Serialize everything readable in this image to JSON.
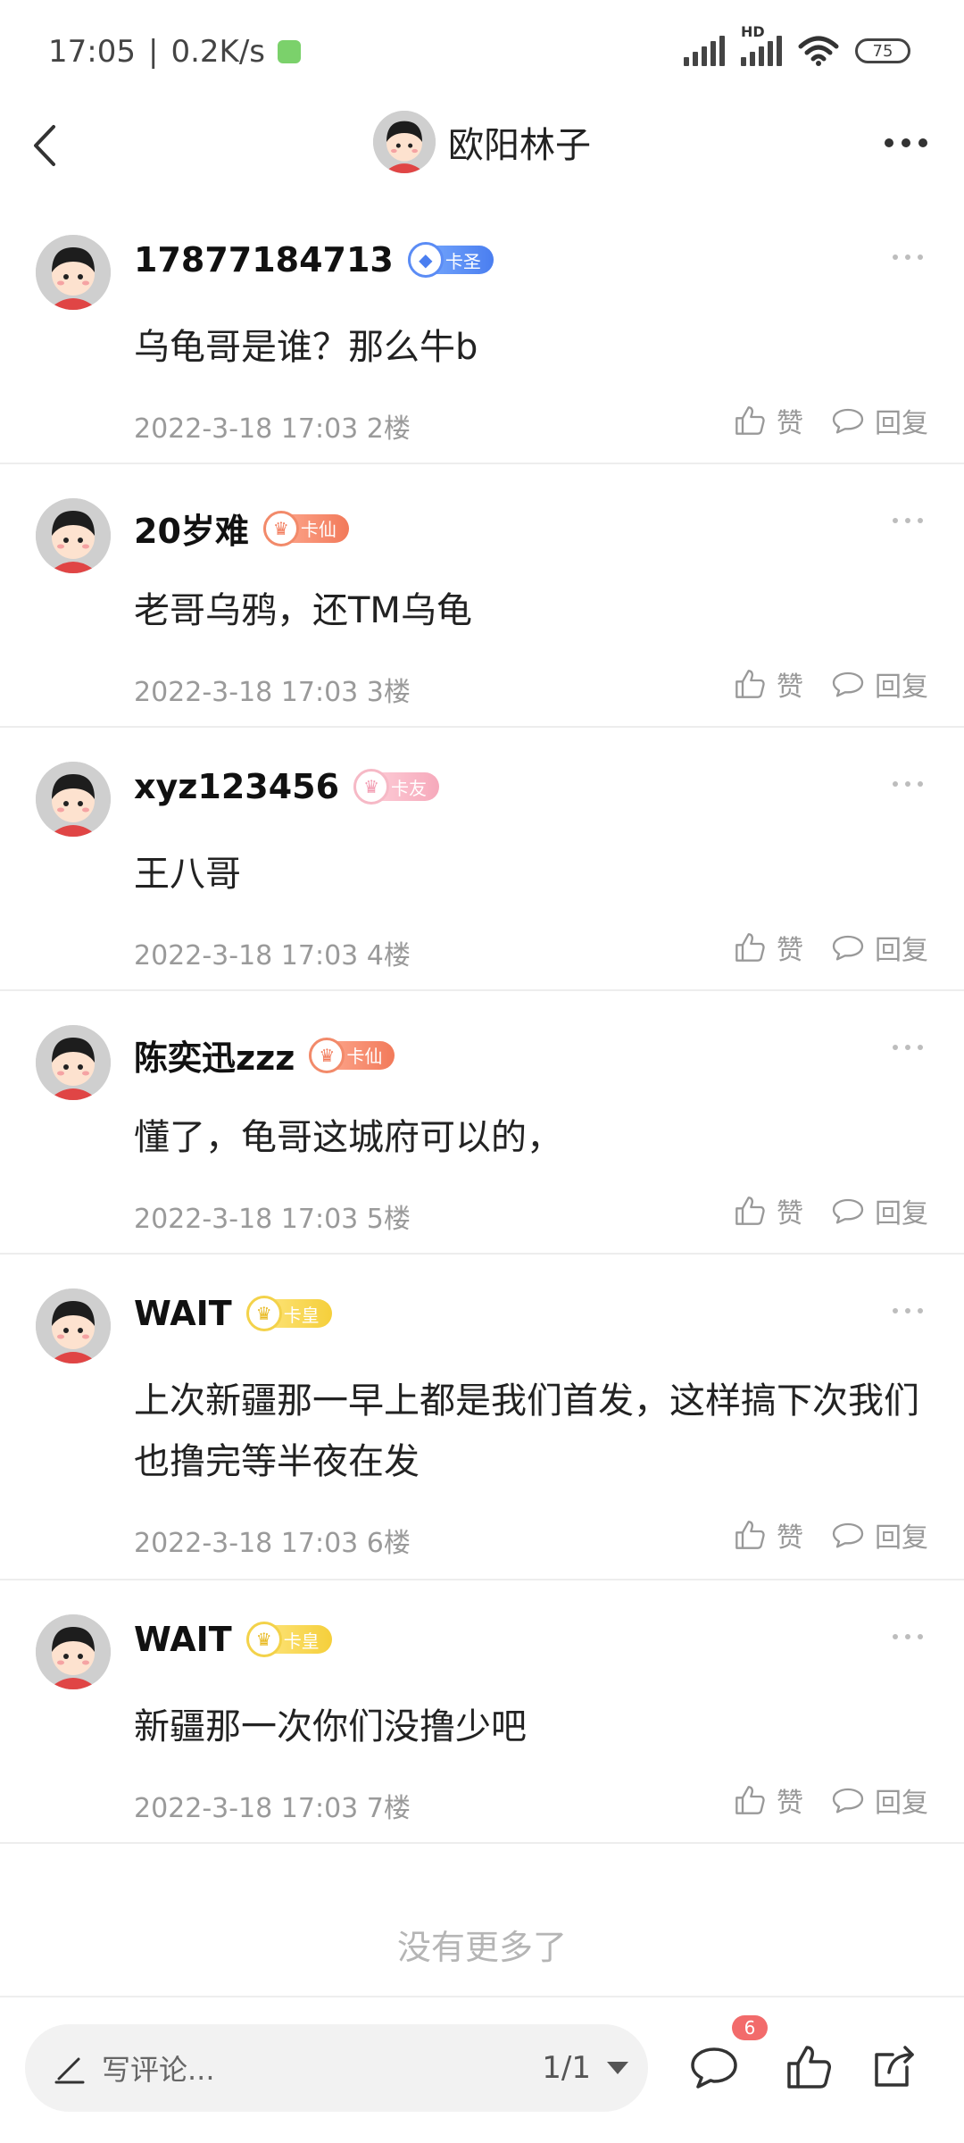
{
  "status_bar": {
    "time": "17:05",
    "speed": "0.2K/s",
    "hd_label": "HD",
    "battery": "75"
  },
  "header": {
    "title": "欧阳林子"
  },
  "comments": [
    {
      "username": "17877184713",
      "badge": "卡圣",
      "content": "乌龟哥是谁？那么牛b",
      "time": "2022-3-18 17:03",
      "floor": "2楼"
    },
    {
      "username": "20岁难",
      "badge": "卡仙",
      "content": "老哥乌鸦，还TM乌龟",
      "time": "2022-3-18 17:03",
      "floor": "3楼"
    },
    {
      "username": "xyz123456",
      "badge": "卡友",
      "content": "王八哥",
      "time": "2022-3-18 17:03",
      "floor": "4楼"
    },
    {
      "username": "陈奕迅zzz",
      "badge": "卡仙",
      "content": "懂了，龟哥这城府可以的，",
      "time": "2022-3-18 17:03",
      "floor": "5楼"
    },
    {
      "username": "WAIT",
      "badge": "卡皇",
      "content": "上次新疆那一早上都是我们首发，这样搞下次我们也撸完等半夜在发",
      "time": "2022-3-18 17:03",
      "floor": "6楼"
    },
    {
      "username": "WAIT",
      "badge": "卡皇",
      "content": "新疆那一次你们没撸少吧",
      "time": "2022-3-18 17:03",
      "floor": "7楼"
    }
  ],
  "actions": {
    "like_label": "赞",
    "reply_label": "回复"
  },
  "no_more": "没有更多了",
  "bottom_bar": {
    "placeholder": "写评论...",
    "page": "1/1",
    "comment_count": "6"
  },
  "colors": {
    "badge_blue": "#4a7ef0",
    "badge_orange": "#f27a5a",
    "badge_pink": "#f6a9bb",
    "badge_yellow": "#f5cf3b",
    "notification_red": "#f26b6b"
  },
  "icons": [
    "back-icon",
    "more-icon",
    "like-icon",
    "reply-icon",
    "pencil-icon",
    "comment-icon",
    "share-icon"
  ]
}
